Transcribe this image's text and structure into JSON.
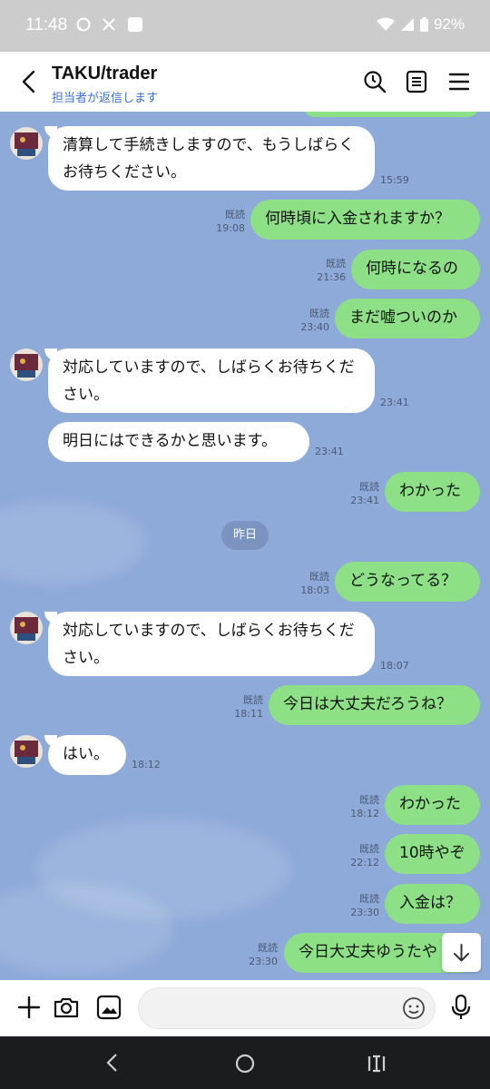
{
  "status_bar": {
    "time": "11:48",
    "battery": "92%"
  },
  "header": {
    "title": "TAKU/trader",
    "subtitle": "担当者が返信します"
  },
  "read_label": "既読",
  "messages": [
    {
      "text": "清算して手続きしますので、もうしばらくお待ちください。",
      "time": "15:59"
    },
    {
      "text": "何時頃に入金されますか？",
      "time": "19:08"
    },
    {
      "text": "何時になるの",
      "time": "21:36"
    },
    {
      "text": "まだ嘘ついのか",
      "time": "23:40"
    },
    {
      "text": "対応していますので、しばらくお待ちください。",
      "time": "23:41"
    },
    {
      "text": "明日にはできるかと思います。",
      "time": "23:41"
    },
    {
      "text": "わかった",
      "time": "23:41"
    },
    {
      "text": "どうなってる？",
      "time": "18:03"
    },
    {
      "text": "対応していますので、しばらくお待ちください。",
      "time": "18:07"
    },
    {
      "text": "今日は大丈夫だろうね？",
      "time": "18:11"
    },
    {
      "text": "はい。",
      "time": "18:12"
    },
    {
      "text": "わかった",
      "time": "18:12"
    },
    {
      "text": "10時やぞ",
      "time": "22:12"
    },
    {
      "text": "入金は？",
      "time": "23:30"
    },
    {
      "text": "今日大丈夫ゆうたや",
      "time": "23:30"
    }
  ],
  "date_divider": "昨日",
  "icons": {
    "back": "chevron-left-icon",
    "search": "search-icon",
    "notes": "notes-icon",
    "menu": "hamburger-menu-icon",
    "plus": "plus-icon",
    "camera": "camera-icon",
    "image": "image-icon",
    "emoji": "emoji-icon",
    "mic": "microphone-icon",
    "scroll": "arrow-down-icon"
  },
  "colors": {
    "outgoing": "#8de086",
    "incoming": "#ffffff",
    "chat_bg": "#8eaad9",
    "link": "#3b6fd6"
  }
}
